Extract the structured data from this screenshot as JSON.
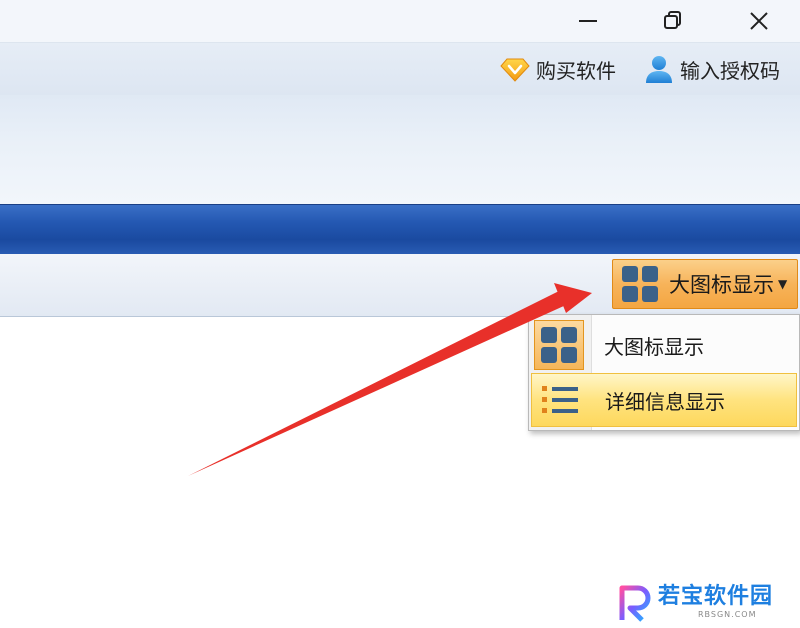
{
  "window": {
    "minimize_icon": "minimize-icon",
    "maximize_icon": "restore-icon",
    "close_icon": "close-icon"
  },
  "top_links": {
    "buy_label": "购买软件",
    "buy_icon": "diamond-icon",
    "license_label": "输入授权码",
    "license_icon": "user-icon"
  },
  "toolbar": {
    "view_button_label": "大图标显示",
    "view_button_icon": "large-icons-icon",
    "caret_icon": "caret-down-icon"
  },
  "view_menu": {
    "items": [
      {
        "label": "大图标显示",
        "icon": "large-icons-icon",
        "state": "checked"
      },
      {
        "label": "详细信息显示",
        "icon": "details-list-icon",
        "state": "hovered"
      }
    ]
  },
  "watermark": {
    "text": "若宝软件园",
    "sub": "RBSGN.COM"
  },
  "colors": {
    "accent_orange": "#f7b35a",
    "hover_yellow": "#ffe37f",
    "ribbon_blue": "#2458b2",
    "annotation_arrow": "#e8302a",
    "tile_blue": "#3b6189"
  }
}
